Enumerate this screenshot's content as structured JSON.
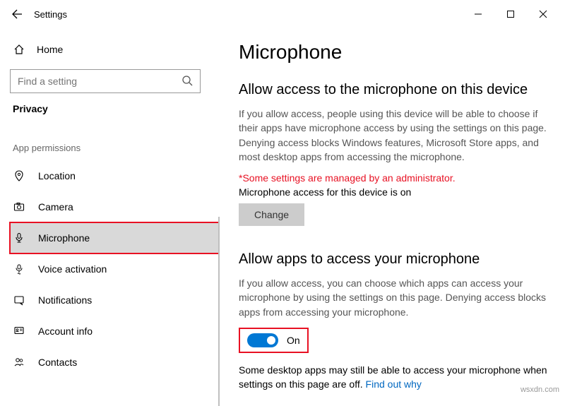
{
  "window": {
    "title": "Settings"
  },
  "sidebar": {
    "home_label": "Home",
    "search_placeholder": "Find a setting",
    "category": "Privacy",
    "group": "App permissions",
    "items": [
      {
        "label": "Location"
      },
      {
        "label": "Camera"
      },
      {
        "label": "Microphone"
      },
      {
        "label": "Voice activation"
      },
      {
        "label": "Notifications"
      },
      {
        "label": "Account info"
      },
      {
        "label": "Contacts"
      }
    ]
  },
  "page": {
    "title": "Microphone",
    "section1": {
      "heading": "Allow access to the microphone on this device",
      "desc": "If you allow access, people using this device will be able to choose if their apps have microphone access by using the settings on this page. Denying access blocks Windows features, Microsoft Store apps, and most desktop apps from accessing the microphone.",
      "admin_note": "*Some settings are managed by an administrator.",
      "status": "Microphone access for this device is on",
      "change_btn": "Change"
    },
    "section2": {
      "heading": "Allow apps to access your microphone",
      "desc": "If you allow access, you can choose which apps can access your microphone by using the settings on this page. Denying access blocks apps from accessing your microphone.",
      "toggle_state": "On",
      "note": "Some desktop apps may still be able to access your microphone when settings on this page are off. ",
      "link": "Find out why"
    }
  },
  "watermark": "wsxdn.com"
}
